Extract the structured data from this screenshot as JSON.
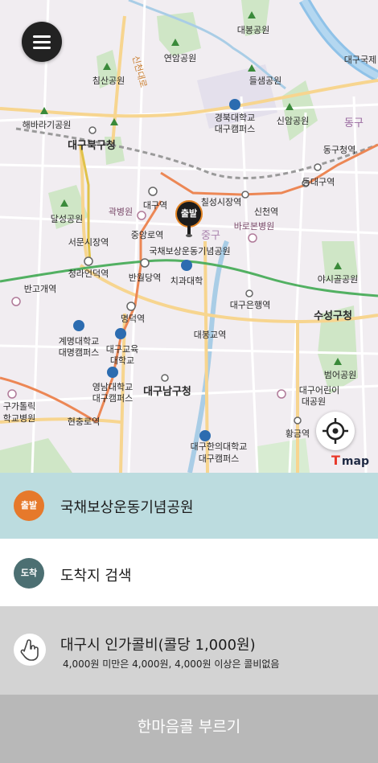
{
  "map": {
    "labels": {
      "daebong_park": "대봉공원",
      "daegu_nat": "대구국제",
      "yeonam_park": "연암공원",
      "deulseong_park": "들샘공원",
      "chimsan_park": "침산공원",
      "sincheon_daero": "신천대로",
      "haebaragi_park": "해바라기공원",
      "knu": "경북대학교",
      "daegu_campus1": "대구캠퍼스",
      "sinam_park": "신암공원",
      "dongdaegu_gu": "동구",
      "buk_gu_office": "대구북구청",
      "dong_gu_office": "동구청역",
      "dongdaegu_station": "동대구역",
      "daegu_station": "대구역",
      "chilseong_market": "칠성시장역",
      "gwangbyeong": "곽병원",
      "sincheon": "신천역",
      "dalseong_park": "달성공원",
      "barobon": "바로본병원",
      "jung_gu": "중구",
      "seomun_market": "서문시장역",
      "jungang_ro": "중앙로역",
      "national_park": "국채보상운동기념공원",
      "cheongna": "청라언덕역",
      "banwoldang": "반월당역",
      "dental": "치과대학",
      "yasigol": "야시골공원",
      "bango": "반고개역",
      "daegueunhaeng": "대구은행역",
      "suseong_gu": "수성구청",
      "myeongdeok": "명덕역",
      "keimyung1": "계명대학교",
      "keimyung2": "대명캠퍼스",
      "daegu_edu1": "대구교육",
      "daegu_edu2": "대학교",
      "daebonggyo": "대봉교역",
      "beomeo_park": "범어공원",
      "yeungnam1": "영남대학교",
      "yeungnam2": "대구캠퍼스",
      "nam_gu_office": "대구남구청",
      "children_park1": "대구어린이",
      "children_park2": "대공원",
      "gatollik1": "구가톨릭",
      "gatollik2": "학교병원",
      "hyeonchung": "현충로역",
      "hwanggeum": "황금역",
      "daegu_hanny1": "대구한의대학교",
      "daegu_hanny2": "대구캠퍼스"
    },
    "pin_label": "출발",
    "logo_text": "map"
  },
  "start": {
    "badge": "출발",
    "place": "국채보상운동기념공원"
  },
  "destination": {
    "badge": "도착",
    "placeholder": "도착지 검색"
  },
  "fare": {
    "title": "대구시 인가콜비(콜당 1,000원)",
    "note": "4,000원 미만은 4,000원, 4,000원 이상은 콜비없음"
  },
  "call_button": {
    "label": "한마음콜 부르기"
  },
  "colors": {
    "start_badge": "#e6792b",
    "dest_badge": "#4c6f72",
    "start_row_bg": "#bcdcdf",
    "call_row_bg": "#b8b8b8"
  },
  "icons": {
    "menu": "hamburger-menu-icon",
    "locate": "crosshair-locate-icon",
    "fare": "hand-tap-icon"
  }
}
